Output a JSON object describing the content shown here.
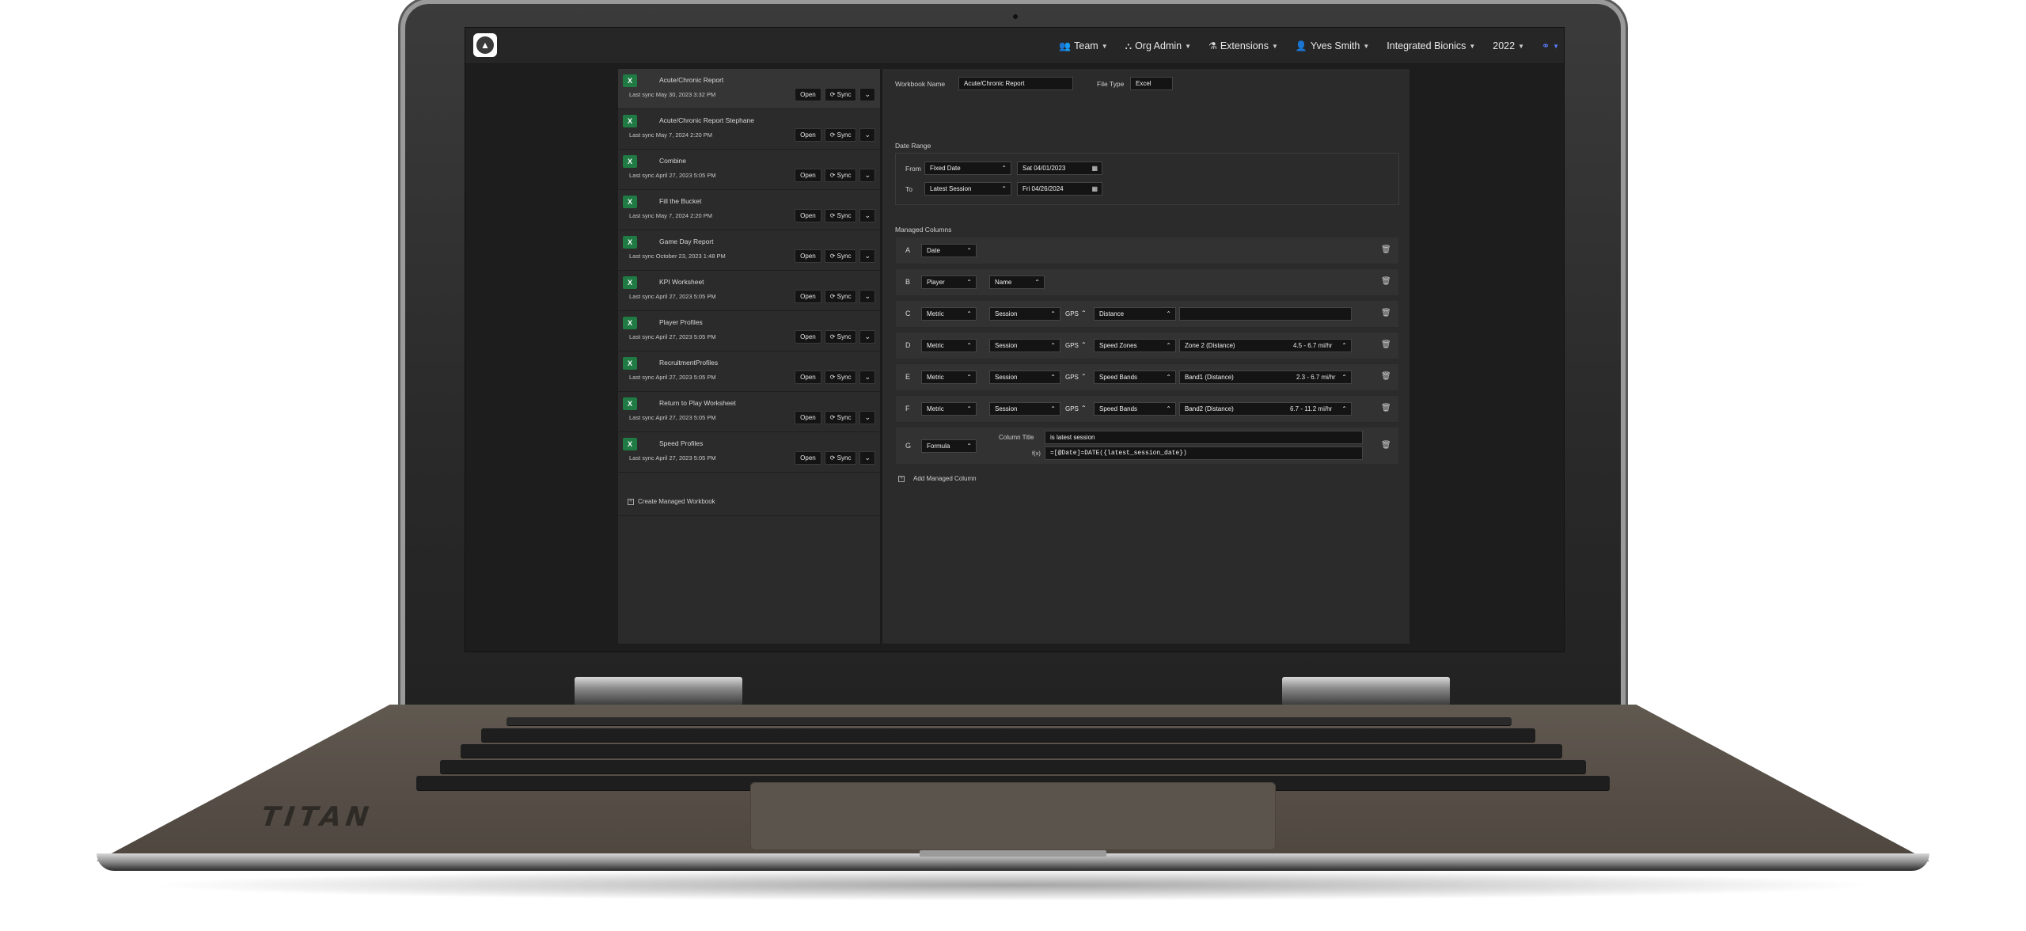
{
  "nav": {
    "items": [
      {
        "icon": "team-icon",
        "glyph": "👥",
        "label": "Team"
      },
      {
        "icon": "org-admin-icon",
        "glyph": "⛬",
        "label": "Org Admin"
      },
      {
        "icon": "extensions-icon",
        "glyph": "⚗",
        "label": "Extensions"
      },
      {
        "icon": "user-icon",
        "glyph": "👤",
        "label": "Yves Smith"
      },
      {
        "icon": "",
        "glyph": "",
        "label": "Integrated Bionics"
      },
      {
        "icon": "",
        "glyph": "",
        "label": "2022"
      }
    ]
  },
  "workbooks": {
    "buttons": {
      "open": "Open",
      "sync": "Sync"
    },
    "items": [
      {
        "title": "Acute/Chronic Report",
        "sync": "Last sync May 30, 2023 3:32 PM"
      },
      {
        "title": "Acute/Chronic Report Stephane",
        "sync": "Last sync May 7, 2024 2:20 PM"
      },
      {
        "title": "Combine",
        "sync": "Last sync April 27, 2023 5:05 PM"
      },
      {
        "title": "Fill the Bucket",
        "sync": "Last sync May 7, 2024 2:20 PM"
      },
      {
        "title": "Game Day Report",
        "sync": "Last sync October 23, 2023 1:48 PM"
      },
      {
        "title": "KPI Worksheet",
        "sync": "Last sync April 27, 2023 5:05 PM"
      },
      {
        "title": "Player Profiles",
        "sync": "Last sync April 27, 2023 5:05 PM"
      },
      {
        "title": "RecruitmentProfiles",
        "sync": "Last sync April 27, 2023 5:05 PM"
      },
      {
        "title": "Return to Play Worksheet",
        "sync": "Last sync April 27, 2023 5:05 PM"
      },
      {
        "title": "Speed Profiles",
        "sync": "Last sync April 27, 2023 5:05 PM"
      }
    ],
    "create_label": "Create Managed Workbook"
  },
  "detail": {
    "workbook_name_label": "Workbook Name",
    "workbook_name": "Acute/Chronic Report",
    "file_type_label": "File Type",
    "file_type": "Excel",
    "date_range_label": "Date Range",
    "from_label": "From",
    "from_type": "Fixed Date",
    "from_date": "Sat 04/01/2023",
    "to_label": "To",
    "to_type": "Latest Session",
    "to_date": "Fri 04/26/2024",
    "managed_columns_label": "Managed Columns",
    "gps": "GPS",
    "columns": {
      "a": {
        "letter": "A",
        "f1": "Date"
      },
      "b": {
        "letter": "B",
        "f1": "Player",
        "f2": "Name"
      },
      "c": {
        "letter": "C",
        "f1": "Metric",
        "f2": "Session",
        "f3": "Distance"
      },
      "d": {
        "letter": "D",
        "f1": "Metric",
        "f2": "Session",
        "f3": "Speed Zones",
        "f4": "Zone 2 (Distance)",
        "range": "4.5 - 6.7 mi/hr"
      },
      "e": {
        "letter": "E",
        "f1": "Metric",
        "f2": "Session",
        "f3": "Speed Bands",
        "f4": "Band1 (Distance)",
        "range": "2.3 - 6.7 mi/hr"
      },
      "f": {
        "letter": "F",
        "f1": "Metric",
        "f2": "Session",
        "f3": "Speed Bands",
        "f4": "Band2 (Distance)",
        "range": "6.7 - 11.2 mi/hr"
      },
      "g": {
        "letter": "G",
        "f1": "Formula",
        "title_label": "Column Title",
        "title": "is latest session",
        "fx": "f(x)",
        "formula": "=[@Date]=DATE({latest_session_date})"
      }
    },
    "add_column_label": "Add Managed Column"
  },
  "laptop": {
    "brand": "TITAN"
  },
  "colors": {
    "accent": "#5a7bff",
    "excel_green": "#1f7a43",
    "panel": "#2b2b2b",
    "row": "#323232"
  }
}
